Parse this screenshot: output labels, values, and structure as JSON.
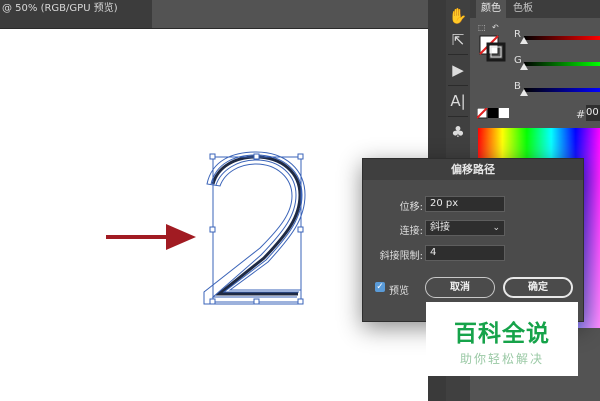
{
  "document_tab": {
    "title": "@ 50% (RGB/GPU 预览)"
  },
  "canvas": {
    "glyph": "2"
  },
  "color_panel": {
    "tabs": [
      "颜色",
      "色板"
    ],
    "sliders": [
      {
        "label": "R",
        "value": 0,
        "color": "#ff0000"
      },
      {
        "label": "G",
        "value": 0,
        "color": "#00ff00"
      },
      {
        "label": "B",
        "value": 0,
        "color": "#0000ff"
      }
    ],
    "hex_symbol": "#",
    "hex_value": "00"
  },
  "dialog": {
    "title": "偏移路径",
    "offset_label": "位移:",
    "offset_value": "20 px",
    "join_label": "连接:",
    "join_value": "斜接",
    "miter_label": "斜接限制:",
    "miter_value": "4",
    "preview_label": "预览",
    "preview_checked": true,
    "cancel_label": "取消",
    "ok_label": "确定"
  },
  "watermark": {
    "title": "百科全说",
    "subtitle": "助你轻松解决"
  },
  "colors": {
    "arrow": "#a11b22",
    "path": "#3a63b8",
    "accent": "#5a9bd8"
  },
  "icons": [
    "puppet-warp-icon",
    "export-icon",
    "play-icon",
    "type-icon",
    "club-icon"
  ]
}
